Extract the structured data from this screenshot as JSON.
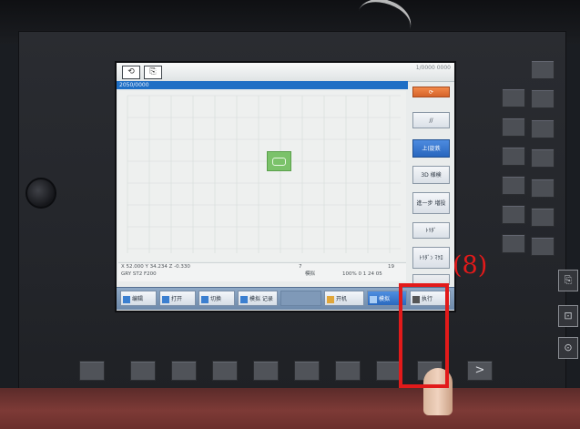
{
  "screen": {
    "title_right": "1/0000\n0000",
    "program_path": "2050/0000",
    "icons": {
      "mode": "step-mode-icon",
      "doc": "program-doc-icon"
    }
  },
  "vertical_softkeys": [
    {
      "label": "",
      "icon": "reset-icon",
      "style": "orange"
    },
    {
      "label": "//",
      "style": "normal"
    },
    {
      "label": "上(旋鉄",
      "style": "blue"
    },
    {
      "label": "3D 様検",
      "style": "normal"
    },
    {
      "label": "進一步\n増投",
      "style": "normal"
    },
    {
      "label": "ﾄﾘﾀﾞ",
      "style": "normal"
    },
    {
      "label": "ﾄﾘﾀﾞﾝ\nﾏｸﾛ",
      "style": "normal"
    },
    {
      "label": "",
      "style": "dim"
    }
  ],
  "status_bar": {
    "coords": "X   52.000   Y   34.234  Z   -0.330",
    "tool": "GRY ST2 F200",
    "value_right": "7",
    "mode_label": "模拟",
    "feed": "100% 0 1 24 05",
    "count": "19"
  },
  "softkeys": [
    {
      "label": "编辑",
      "icon": "edit-icon"
    },
    {
      "label": "打开",
      "icon": "open-icon"
    },
    {
      "label": "切换",
      "icon": "switch-icon"
    },
    {
      "label": "模拟\n记录",
      "icon": "simulate-icon"
    },
    {
      "label": "",
      "icon": ""
    },
    {
      "label": "开机",
      "icon": "grid-icon"
    },
    {
      "label": "模拟",
      "icon": "simulation-icon",
      "active": true
    },
    {
      "label": "执行",
      "icon": "execute-icon"
    }
  ],
  "annotation": {
    "label": "(8)",
    "color": "#e21a1a"
  },
  "right_panel_keys": [
    ">",
    "⎘",
    "⊡",
    "⊙"
  ],
  "colors": {
    "accent_blue": "#1f6fc5",
    "annotation_red": "#e21a1a",
    "reset_orange": "#d4632a",
    "green_marker": "#7bc26a"
  }
}
